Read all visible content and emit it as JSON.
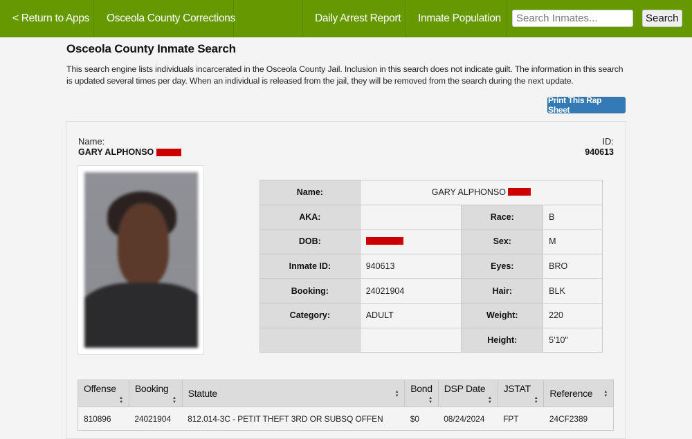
{
  "nav": {
    "return_label": "< Return to Apps",
    "site_title": "Osceola County Corrections",
    "daily_arrest": "Daily Arrest Report",
    "inmate_population": "Inmate Population",
    "search_placeholder": "Search Inmates...",
    "search_value": "",
    "search_button": "Search",
    "brand_color": "#669900"
  },
  "page": {
    "title": "Osceola County Inmate Search",
    "intro": "This search engine lists individuals incarcerated in the Osceola County Jail. Inclusion in this search does not indicate guilt. The information in this search is updated several times per day. When an individual is released from the jail, they will be removed from the search during the next update.",
    "print_button": "Print This Rap Sheet",
    "print_button_color": "#337ab7"
  },
  "inmate": {
    "name_label": "Name:",
    "name": "GARY ALPHONSO",
    "id_label": "ID:",
    "id": "940613",
    "photo_alt": "Inmate booking photo (blurred)",
    "redaction_color": "#cc0000"
  },
  "details": {
    "name_label": "Name:",
    "name_value": "GARY ALPHONSO",
    "aka_label": "AKA:",
    "aka_value": "",
    "race_label": "Race:",
    "race_value": "B",
    "dob_label": "DOB:",
    "sex_label": "Sex:",
    "sex_value": "M",
    "inmate_id_label": "Inmate ID:",
    "inmate_id_value": "940613",
    "eyes_label": "Eyes:",
    "eyes_value": "BRO",
    "booking_label": "Booking:",
    "booking_value": "24021904",
    "hair_label": "Hair:",
    "hair_value": "BLK",
    "category_label": "Category:",
    "category_value": "ADULT",
    "weight_label": "Weight:",
    "weight_value": "220",
    "height_label": "Height:",
    "height_value": "5'10\""
  },
  "offenses": {
    "columns": [
      "Offense",
      "Booking",
      "Statute",
      "Bond",
      "DSP Date",
      "JSTAT",
      "Reference"
    ],
    "rows": [
      {
        "offense": "810896",
        "booking": "24021904",
        "statute": "812.014-3C - PETIT THEFT 3RD OR SUBSQ OFFEN",
        "bond": "$0",
        "dsp_date": "08/24/2024",
        "jstat": "FPT",
        "reference": "24CF2389"
      }
    ]
  }
}
